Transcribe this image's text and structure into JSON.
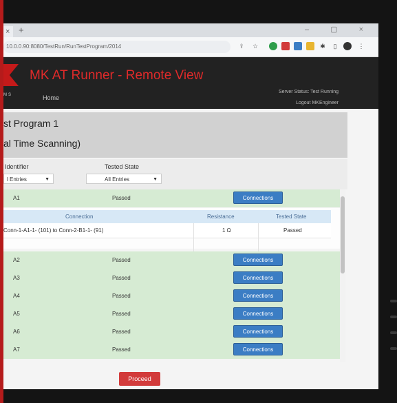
{
  "browser": {
    "url": "10.0.0.90:8080/TestRun/RunTestProgram/2014",
    "tab_close": "×",
    "tab_new": "+",
    "window_controls": "– ▢ ×"
  },
  "app": {
    "title": "MK AT Runner - Remote View",
    "nav_home": "Home",
    "server_status": "Server Status: Test Running",
    "logout": "Logout MKEngineer",
    "logo_text": "MS",
    "accent": "#e02a2a"
  },
  "program": {
    "title": "st Program 1",
    "subtitle": "al Time Scanning)"
  },
  "filters": {
    "identifier_label": "Identifier",
    "identifier_value": "l Entries",
    "state_label": "Tested State",
    "state_value": "All Entries"
  },
  "rows": [
    {
      "id": "A1",
      "state": "Passed",
      "button": "Connections"
    },
    {
      "id": "A2",
      "state": "Passed",
      "button": "Connections"
    },
    {
      "id": "A3",
      "state": "Passed",
      "button": "Connections"
    },
    {
      "id": "A4",
      "state": "Passed",
      "button": "Connections"
    },
    {
      "id": "A5",
      "state": "Passed",
      "button": "Connections"
    },
    {
      "id": "A6",
      "state": "Passed",
      "button": "Connections"
    },
    {
      "id": "A7",
      "state": "Passed",
      "button": "Connections"
    }
  ],
  "detail": {
    "headers": [
      "Connection",
      "Resistance",
      "Tested State"
    ],
    "connection": "Conn-1-A1-1- (101) to Conn-2-B1-1- (91)",
    "resistance": "1 Ω",
    "tested_state": "Passed"
  },
  "proceed_label": "Proceed"
}
